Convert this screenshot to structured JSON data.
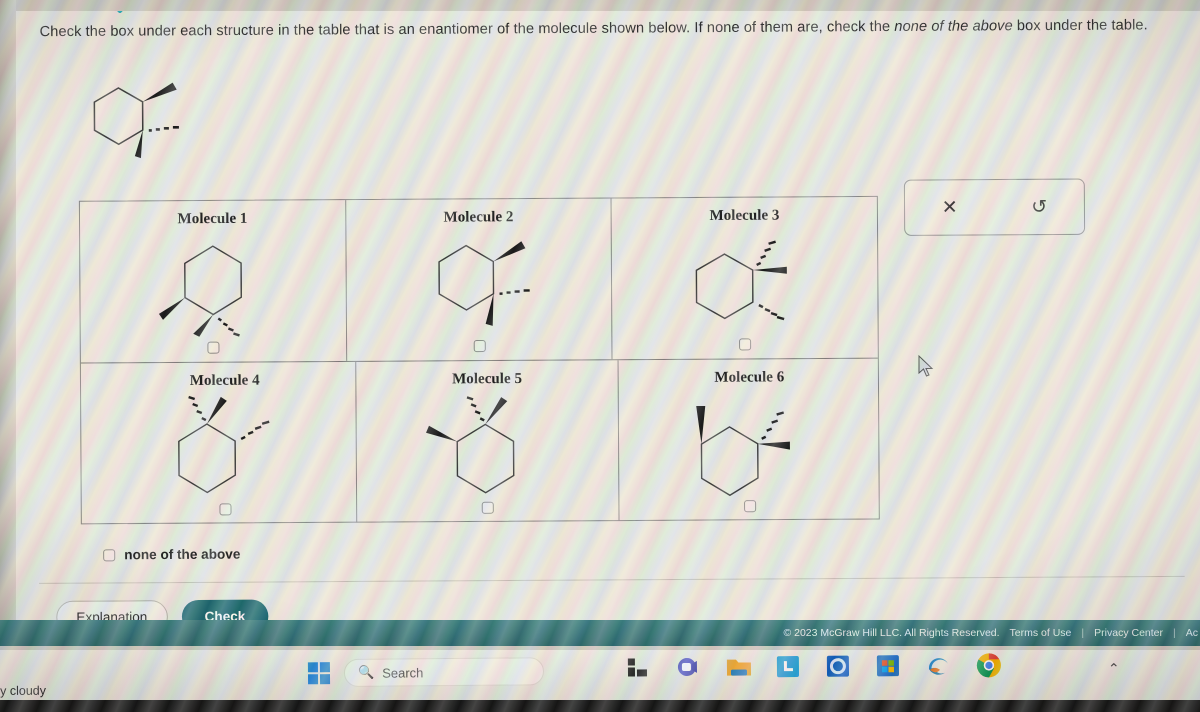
{
  "prompt": {
    "part1": "Check the box under each structure in the table that is an enantiomer of the molecule shown below. If none of them are, check the ",
    "italic": "none of the above",
    "part2": " box under the table."
  },
  "toolbar": {
    "clear_icon": "close-x-icon",
    "clear_glyph": "✕",
    "undo_icon": "undo-arrow-icon",
    "undo_glyph": "↺"
  },
  "reference_molecule": {
    "name": "reference-molecule",
    "ring": "cyclohexane",
    "substituents": [
      {
        "position": "C1-upper-right",
        "bond": "wedge",
        "direction": "up-right"
      },
      {
        "position": "C2-right",
        "bond": "hash",
        "direction": "right"
      },
      {
        "position": "C2-lower",
        "bond": "wedge",
        "direction": "down-right"
      }
    ]
  },
  "table": {
    "rows": [
      [
        {
          "label": "Molecule 1",
          "checked": false,
          "substituents": [
            {
              "vertex": "left-lower",
              "bond": "wedge",
              "direction": "down-left"
            },
            {
              "vertex": "bottom-right",
              "bond": "wedge",
              "direction": "down-left"
            },
            {
              "vertex": "bottom-right",
              "bond": "hash",
              "direction": "down-right"
            }
          ]
        },
        {
          "label": "Molecule 2",
          "checked": false,
          "substituents": [
            {
              "vertex": "top-right",
              "bond": "wedge",
              "direction": "up-right"
            },
            {
              "vertex": "right-lower",
              "bond": "hash",
              "direction": "right"
            },
            {
              "vertex": "right-lower",
              "bond": "wedge",
              "direction": "down-right"
            }
          ]
        },
        {
          "label": "Molecule 3",
          "checked": false,
          "substituents": [
            {
              "vertex": "top-right",
              "bond": "hash",
              "direction": "up-right"
            },
            {
              "vertex": "top-right",
              "bond": "wedge",
              "direction": "right"
            },
            {
              "vertex": "bottom-right",
              "bond": "hash",
              "direction": "down-right"
            }
          ]
        }
      ],
      [
        {
          "label": "Molecule 4",
          "checked": false,
          "substituents": [
            {
              "vertex": "top",
              "bond": "hash",
              "direction": "up-left"
            },
            {
              "vertex": "top",
              "bond": "wedge",
              "direction": "up-right"
            },
            {
              "vertex": "upper-right",
              "bond": "hash",
              "direction": "up-right"
            }
          ]
        },
        {
          "label": "Molecule 5",
          "checked": false,
          "substituents": [
            {
              "vertex": "top",
              "bond": "hash",
              "direction": "up-left"
            },
            {
              "vertex": "top",
              "bond": "wedge",
              "direction": "up-right"
            },
            {
              "vertex": "upper-left",
              "bond": "wedge",
              "direction": "up-left"
            }
          ]
        },
        {
          "label": "Molecule 6",
          "checked": false,
          "substituents": [
            {
              "vertex": "top-left",
              "bond": "wedge",
              "direction": "up"
            },
            {
              "vertex": "top-right",
              "bond": "hash",
              "direction": "up-right"
            },
            {
              "vertex": "top-right",
              "bond": "wedge",
              "direction": "right"
            }
          ]
        }
      ]
    ]
  },
  "none_of_the_above": {
    "label": "none of the above",
    "checked": false
  },
  "buttons": {
    "explanation": "Explanation",
    "check": "Check"
  },
  "footer": {
    "copyright": "© 2023 McGraw Hill LLC. All Rights Reserved.",
    "terms": "Terms of Use",
    "privacy": "Privacy Center",
    "accessibility": "Ac",
    "separator": "|"
  },
  "taskbar": {
    "weather": "y cloudy",
    "search_placeholder": "Search",
    "search_icon": "search-magnifier-icon",
    "start_icon": "windows-start-icon",
    "tray_icon": "chevron-up-icon",
    "tray_glyph": "⌃",
    "apps": [
      {
        "name": "widgets-icon",
        "color": "#2b2b2b"
      },
      {
        "name": "teams-icon",
        "color": "#5b5fc7"
      },
      {
        "name": "file-explorer-icon",
        "color": "#f0ac3a"
      },
      {
        "name": "linkedin-learning-icon",
        "color": "#2aa3e0"
      },
      {
        "name": "outlook-icon",
        "color": "#1160c4"
      },
      {
        "name": "microsoft-store-icon",
        "color": "#1f70c8"
      },
      {
        "name": "edge-icon",
        "color": "#2a8fc9"
      },
      {
        "name": "chrome-icon",
        "color": "#3d8cf0"
      }
    ]
  },
  "colors": {
    "check_button": "#1d6b73",
    "footer_band": "#2d6a6e",
    "page_bg": "#eceae4",
    "chevron_accent": "#23b2c0",
    "table_border": "#8b8b8b"
  }
}
